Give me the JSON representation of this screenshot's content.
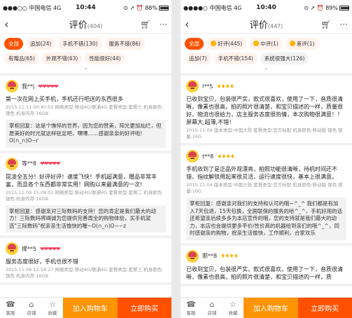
{
  "left": {
    "status": {
      "carrier": "●●●○○ 中国电信  4G",
      "time": "10:44",
      "icons": "⊙ ➚ ⏰ 88%",
      "battery_level": 0.88
    },
    "nav": {
      "title": "评价",
      "count": "(404)"
    },
    "tags": [
      {
        "label": "全部",
        "active": true
      },
      {
        "label": "追加(24)"
      },
      {
        "label": "手机不错(130)"
      },
      {
        "label": "服务不错(86)"
      },
      {
        "label": "有赠品(65)"
      },
      {
        "label": "外观不错(63)"
      },
      {
        "label": "性能很好(44)"
      }
    ],
    "reviews": [
      {
        "user": "我**j",
        "badge": "❤❤❤❤❤",
        "text": "第一次在网上买手机，手机还行吧送的东西很多",
        "meta": "2015.11.11 00:40:01 网络类型:移动4G/联通4G 套餐类型:套餐七 机身颜色:银色 机身内存:16GB",
        "reply": "掌柜回复：这是个憔悴的世界，因为您的赞美，阳光更加灿烂，但愿美好的时光就这样驻足吧，嘿嘿……感谢亲亲的好评啦! O(∩_∩)O~r"
      },
      {
        "user": "等**8",
        "badge": "❤❤❤❤❤",
        "text": "昆凌全五分！好评好评！速度飞快！手机超满意，赠品非常丰富，而且各个东西都非常实用！网购以来最满意的一次!",
        "meta": "2015.11.09 15:08:01 网络类型:移动4G/联通4G 套餐类型:套餐二 机身颜色:银色 机身内存:16GB",
        "reply": "掌柜回复：感谢亲对三际数码的支持！您的肯定是我们最大的动力！三际数码将竭诚为您提供完善周全的购物体验，买手机就选\"三际数码\"祝亲亲生活愉快的喔~O(∩_∩)O~~z"
      },
      {
        "user": "撵**5",
        "badge": "❤❤❤❤❤",
        "text": "服务态度很好，手机也很不错",
        "meta": "2015.11.09 12:58:27 网络类型:移动4G/联通4G 套餐类型:套餐三 机身颜色:银色 机身内存:16GB",
        "reply": ""
      }
    ],
    "bottom": {
      "icon1": "客服",
      "icon2": "店铺",
      "icon3": "收藏",
      "cart": "加入购物车",
      "buy": "立即购买"
    }
  },
  "right": {
    "status": {
      "carrier": "●●●●○ 中国电信  4G",
      "time": "10:40",
      "icons": "⊙ ➚ ⏰ 89%",
      "battery_level": 0.89
    },
    "nav": {
      "title": "评价",
      "count": "(447)"
    },
    "tags": [
      {
        "label": "全部",
        "active": true
      },
      {
        "label": "好评(445)",
        "face": true
      },
      {
        "label": "中评(1)",
        "face": true
      },
      {
        "label": "差评(1)",
        "face": true
      },
      {
        "label": "追加(7)"
      },
      {
        "label": "手机不错(154)"
      },
      {
        "label": "系统很强大(126)",
        "neg": true
      }
    ],
    "reviews": [
      {
        "user": "l**5",
        "badge": "♦♦♦♦",
        "text": "已收到宝贝，包装很严实，款式很喜欢，使用了一下，音质很清晰，像素也很高，拍的照片很清楚，和宝贝描述的一样，质量很好，物流也很给力，店主服务态度很热情，本次购物很满意！！屏幕大,超薄,不错！",
        "meta": "2015-11-09 版本类型:中国大陆 套餐类型:官方标配 机身颜色:移动版 银色 容量:16G",
        "reply": ""
      },
      {
        "user": "t**8",
        "badge": "♦♦♦♦",
        "text": "手机收到了是正品外观漂亮，拍照功能很清晰，待机时间还不错，指纹解锁用起来很灵活，运行速度很快，基本上很满意。",
        "meta": "2015-11-04 版本类型:中国大陆 套餐类型:官方标配 机身颜色:移动版 银色 容量:16G",
        "reply": "掌柜回复：感谢亲对我们的支持和认可的哦~^_^ 我们都是有加入7天包退，15天包换，全国联保的服务的哈^_^，手机好用的话还希望亲后续多多为本店宣传的哦，您的支持就是我们最大的动力，本店也会提供更多平价/性价高的机器给到亲们的哦^_^，同时感谢亲的购物，祝亲生活愉快，工作顺利，合家欢乐"
      },
      {
        "user": "那**8",
        "badge": "♦♦♦♦",
        "text": "已收到宝贝，包装很严实，款式很喜欢，使用了一下，音质很清晰，像素也很高，拍的照片很清楚，和宝贝描述的一样，质",
        "meta": "",
        "reply": ""
      }
    ],
    "bottom": {
      "icon1": "客服",
      "icon2": "店铺",
      "icon3": "收藏",
      "cart": "加入购物车",
      "buy": "立即购买"
    }
  }
}
